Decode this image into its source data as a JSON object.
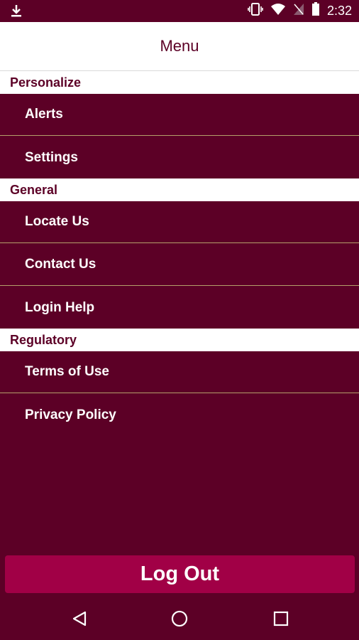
{
  "status_bar": {
    "time": "2:32",
    "icons": [
      "download-icon",
      "vibrate-icon",
      "wifi-icon",
      "no-signal-icon",
      "battery-icon"
    ]
  },
  "header": {
    "title": "Menu"
  },
  "sections": [
    {
      "title": "Personalize",
      "items": [
        {
          "label": "Alerts"
        },
        {
          "label": "Settings"
        }
      ]
    },
    {
      "title": "General",
      "items": [
        {
          "label": "Locate Us"
        },
        {
          "label": "Contact Us"
        },
        {
          "label": "Login Help"
        }
      ]
    },
    {
      "title": "Regulatory",
      "items": [
        {
          "label": "Terms of Use"
        },
        {
          "label": "Privacy Policy"
        }
      ]
    }
  ],
  "logout": {
    "label": "Log Out"
  },
  "nav_bar": {
    "buttons": [
      "back-icon",
      "home-icon",
      "recents-icon"
    ]
  },
  "colors": {
    "brand": "#5c0026",
    "accent": "#a10046",
    "divider": "#b4a06a",
    "header_bg": "#ffffff"
  }
}
